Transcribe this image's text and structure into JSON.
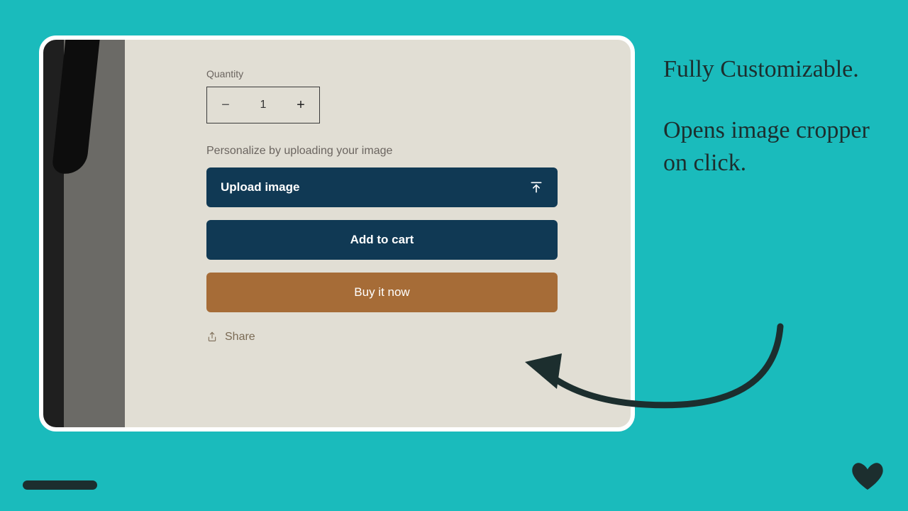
{
  "quantity": {
    "label": "Quantity",
    "value": "1",
    "minus": "−",
    "plus": "+"
  },
  "personalize_label": "Personalize by uploading your image",
  "buttons": {
    "upload": "Upload image",
    "add_to_cart": "Add to cart",
    "buy_now": "Buy it now"
  },
  "share": {
    "label": "Share"
  },
  "callout": {
    "line1": "Fully Customizable.",
    "line2": "Opens image cropper on click."
  },
  "colors": {
    "bg_teal": "#1ABBBC",
    "card_bg": "#E1DED4",
    "primary_dark": "#103954",
    "accent_brown": "#A66C37",
    "ink": "#1c2e2e"
  }
}
